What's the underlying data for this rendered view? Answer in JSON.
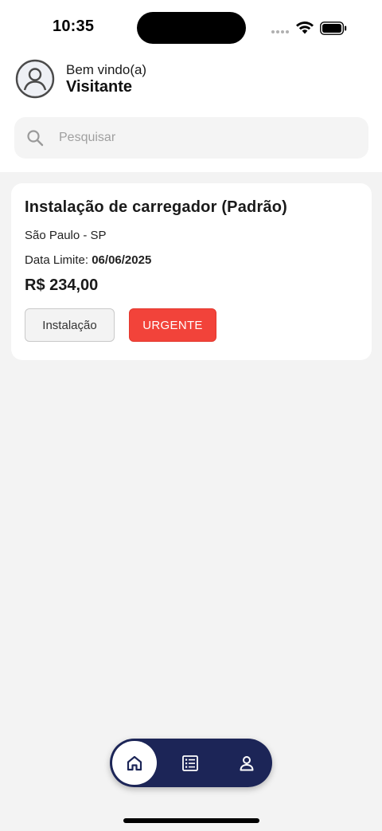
{
  "status_bar": {
    "time": "10:35"
  },
  "header": {
    "greeting": "Bem vindo(a)",
    "user_name": "Visitante",
    "avatar_icon": "user-circle-icon"
  },
  "search": {
    "placeholder": "Pesquisar",
    "value": "",
    "icon": "search-icon"
  },
  "cards": [
    {
      "title": "Instalação de carregador (Padrão)",
      "location": "São Paulo - SP",
      "deadline_label": "Data Limite:",
      "deadline_value": "06/06/2025",
      "price": "R$ 234,00",
      "category_tag": "Instalação",
      "priority_tag": "URGENTE"
    }
  ],
  "bottom_nav": {
    "items": [
      {
        "name": "home",
        "icon": "home-icon",
        "active": true
      },
      {
        "name": "list",
        "icon": "list-icon",
        "active": false
      },
      {
        "name": "profile",
        "icon": "profile-icon",
        "active": false
      }
    ]
  },
  "colors": {
    "nav_background": "#1c2557",
    "urgent": "#f2433a",
    "page_background": "#f3f3f3"
  }
}
